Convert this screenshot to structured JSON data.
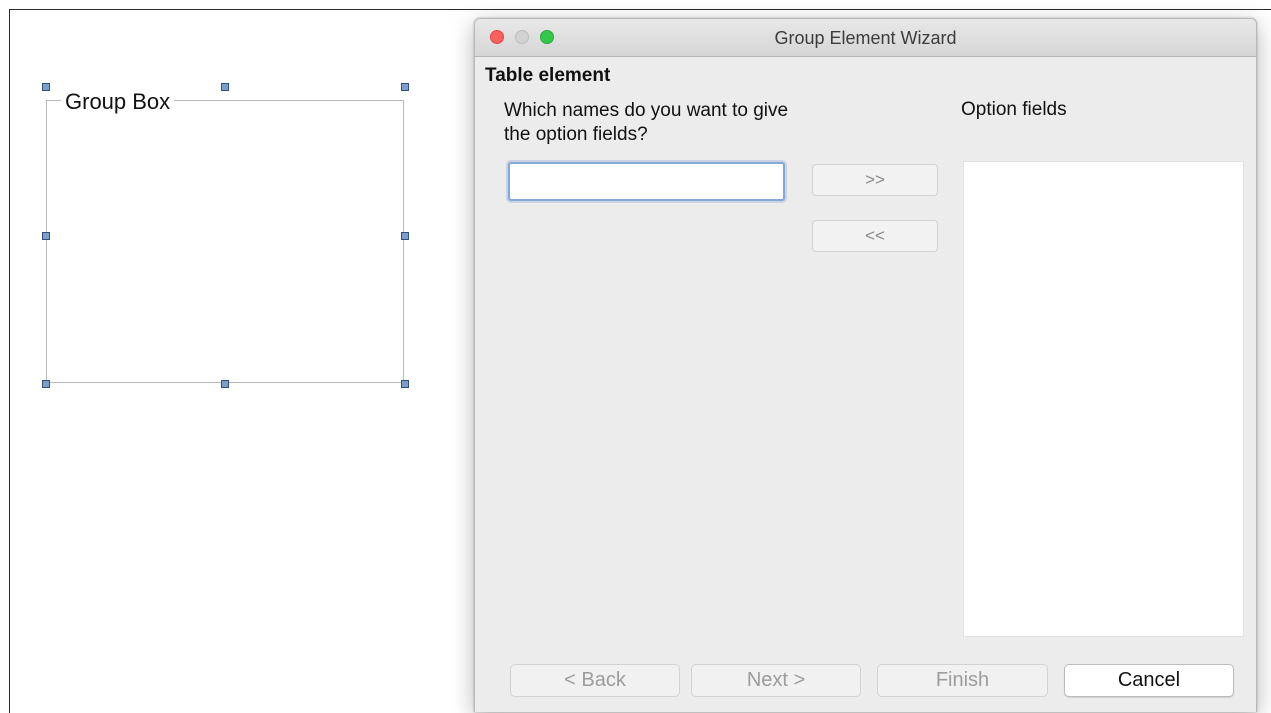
{
  "canvas": {
    "group_box_label": "Group Box"
  },
  "dialog": {
    "title": "Group Element Wizard",
    "section_heading": "Table element",
    "question": "Which names do you want to give the option fields?",
    "list_label": "Option fields",
    "name_input": {
      "value": "",
      "placeholder": ""
    },
    "add_label": ">>",
    "remove_label": "<<",
    "footer": {
      "back_label": "< Back",
      "next_label": "Next >",
      "finish_label": "Finish",
      "cancel_label": "Cancel"
    }
  },
  "colors": {
    "close": "#fc605c",
    "minimize": "#d2d2d2",
    "maximize": "#34c84a",
    "handle": "#7f9dc9",
    "focus_ring": "#86a8d8"
  }
}
